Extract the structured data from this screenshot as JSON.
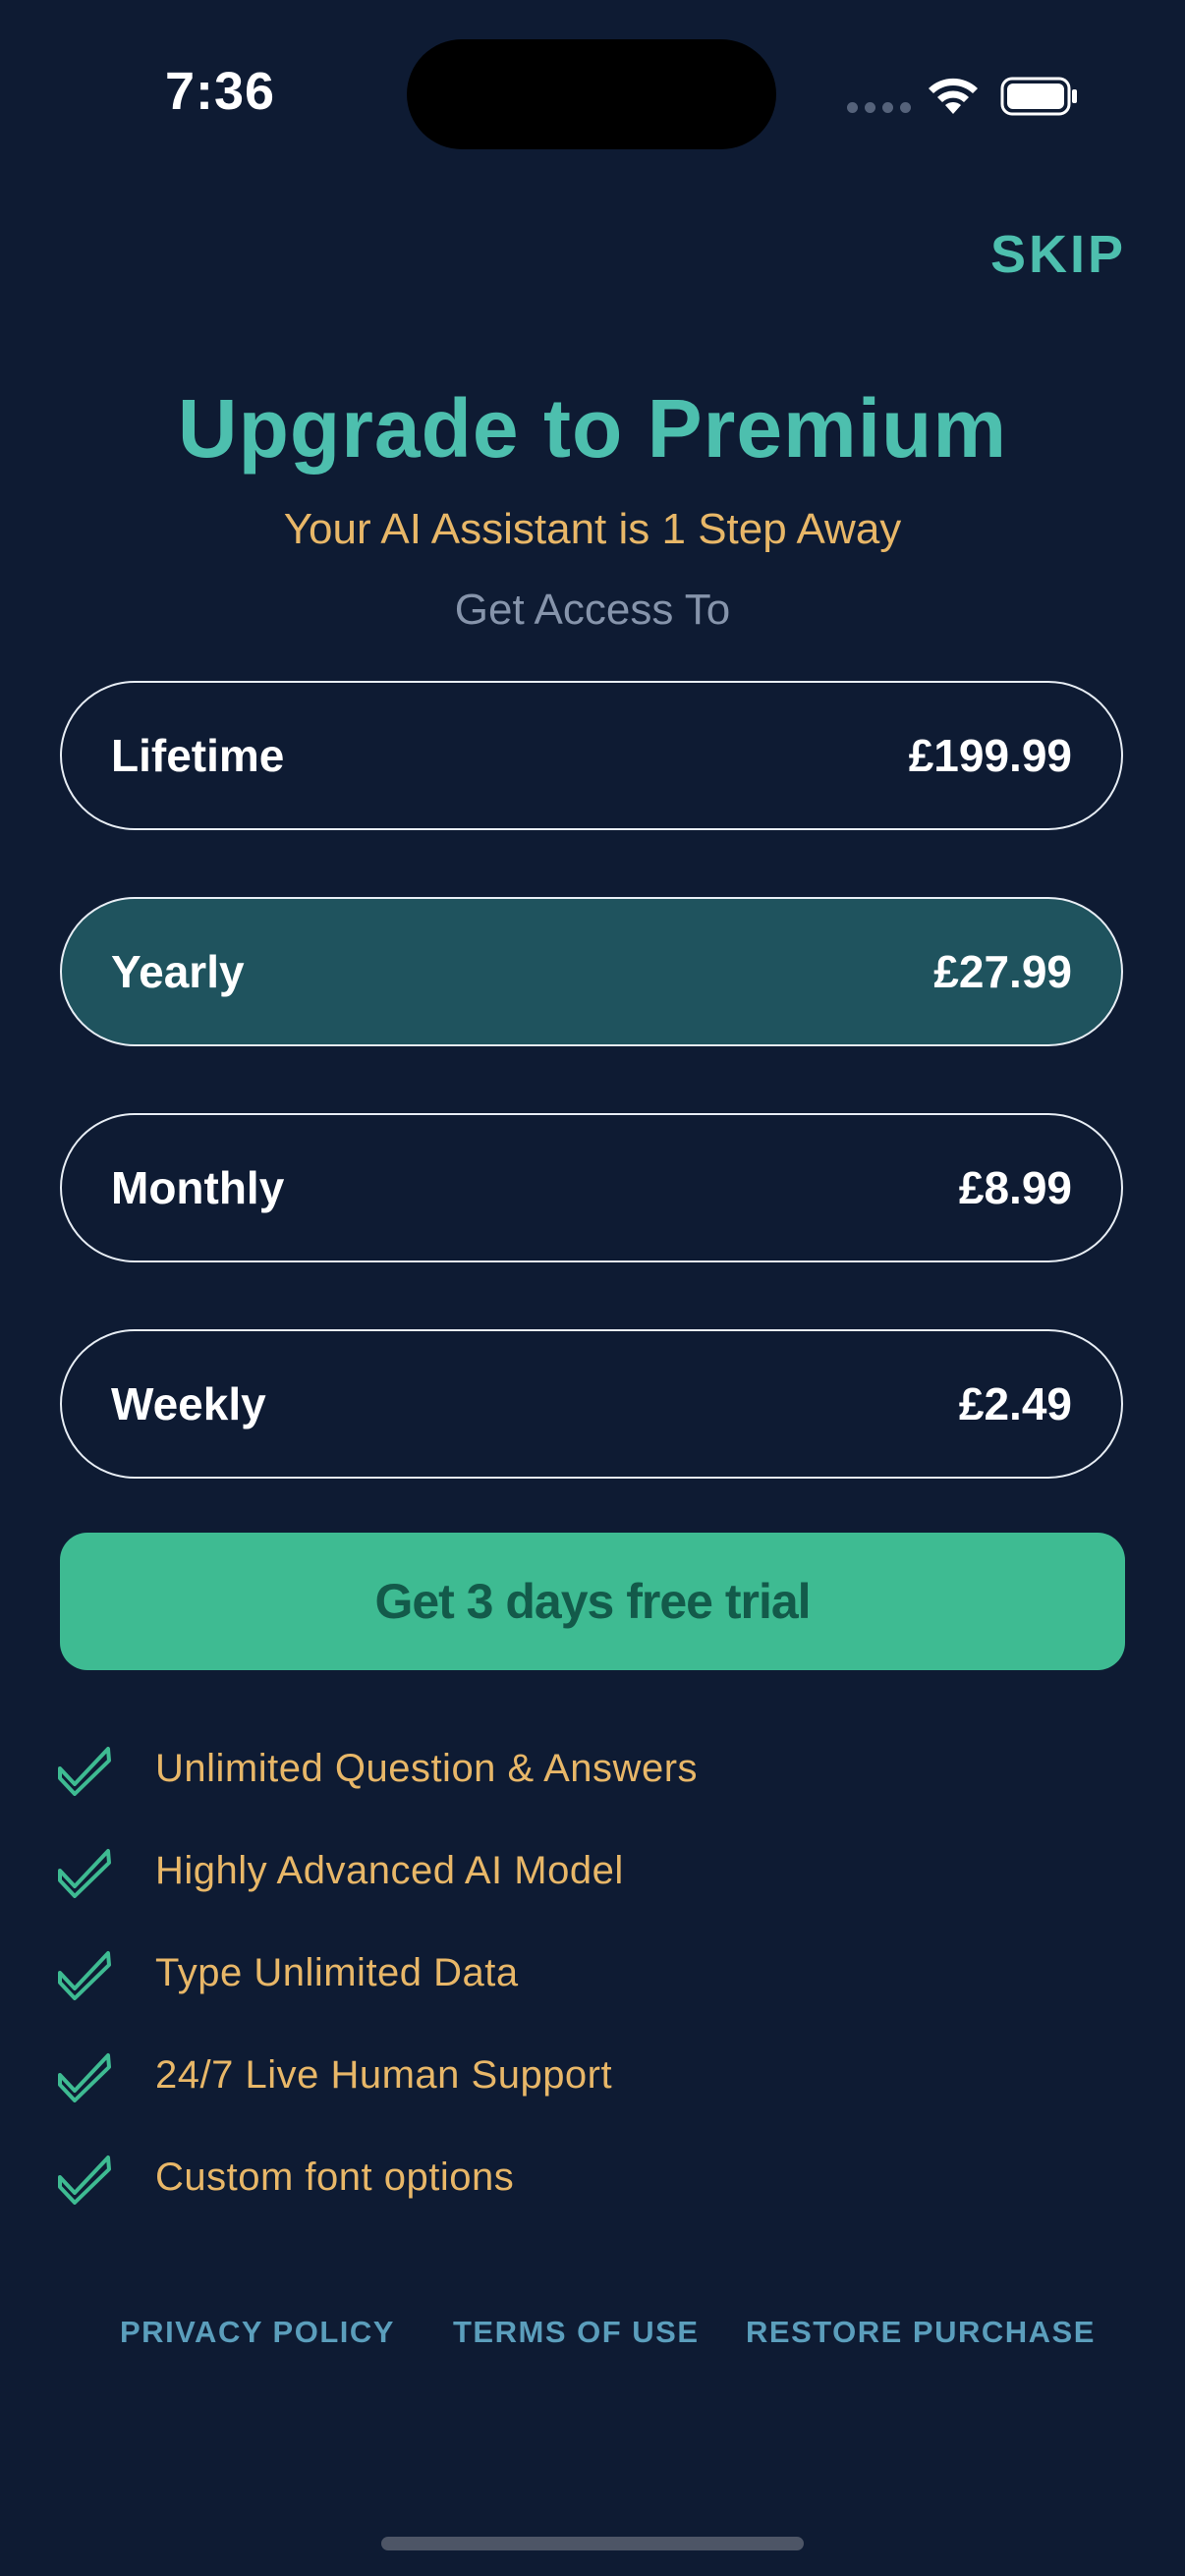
{
  "status_bar": {
    "time": "7:36"
  },
  "header": {
    "skip_label": "SKIP"
  },
  "hero": {
    "title": "Upgrade to Premium",
    "subtitle": "Your AI Assistant is 1 Step Away",
    "access_label": "Get Access To"
  },
  "plans": [
    {
      "name": "Lifetime",
      "price": "£199.99",
      "selected": false
    },
    {
      "name": "Yearly",
      "price": "£27.99",
      "selected": true
    },
    {
      "name": "Monthly",
      "price": "£8.99",
      "selected": false
    },
    {
      "name": "Weekly",
      "price": "£2.49",
      "selected": false
    }
  ],
  "cta": {
    "label": "Get 3 days free trial"
  },
  "features": [
    "Unlimited Question & Answers",
    "Highly Advanced AI Model",
    "Type Unlimited Data",
    "24/7 Live Human Support",
    "Custom font options"
  ],
  "footer": {
    "privacy": "PRIVACY POLICY",
    "terms": "TERMS OF USE",
    "restore": "RESTORE PURCHASE"
  },
  "colors": {
    "background": "#0e1b33",
    "accent_teal": "#4dbfae",
    "accent_gold": "#e8b768",
    "cta_green": "#3ebb92",
    "selected_plan": "#1f535e",
    "footer_link": "#5b9ebc"
  },
  "icons": {
    "feature_check": "checkmark-icon",
    "wifi": "wifi-icon",
    "battery": "battery-icon",
    "signal": "cellular-signal-icon"
  }
}
